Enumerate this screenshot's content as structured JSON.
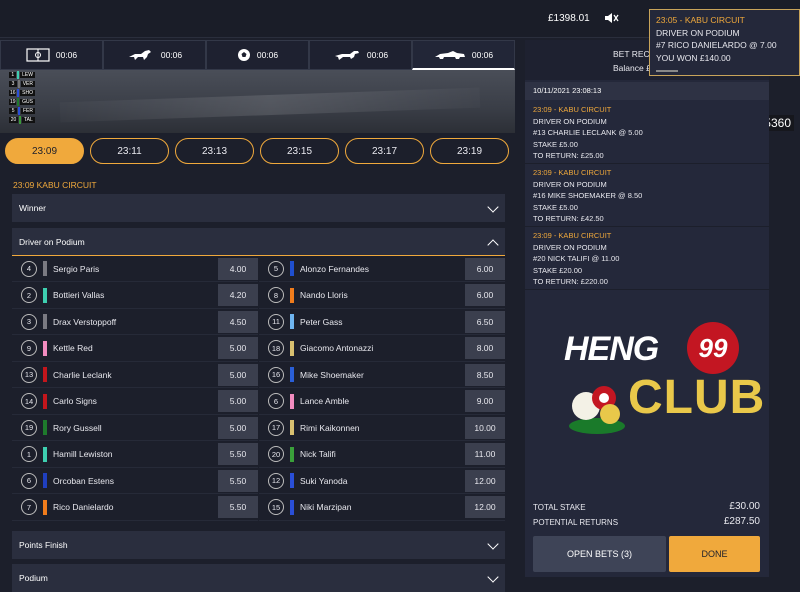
{
  "header": {
    "balance": "£1398.01"
  },
  "notification": {
    "title": "23:05 - KABU CIRCUIT",
    "line1": "DRIVER ON PODIUM",
    "line2": "#7 RICO DANIELARDO @ 7.00",
    "line3": "YOU WON £140.00"
  },
  "sport_tabs": [
    {
      "icon": "soccer-pitch-icon",
      "time": "00:06"
    },
    {
      "icon": "horse-racing-icon",
      "time": "00:06"
    },
    {
      "icon": "football-icon",
      "time": "00:06"
    },
    {
      "icon": "greyhound-icon",
      "time": "00:06"
    },
    {
      "icon": "motor-racing-icon",
      "time": "00:06"
    }
  ],
  "video": {
    "id_label": "ID:1065360",
    "standings": [
      {
        "pos": "1",
        "abbr": "LEW",
        "color": "#3ecfb0"
      },
      {
        "pos": "3",
        "abbr": "VER",
        "color": "#777777"
      },
      {
        "pos": "16",
        "abbr": "SHO",
        "color": "#2a4fd8"
      },
      {
        "pos": "19",
        "abbr": "GUS",
        "color": "#1e7a2c"
      },
      {
        "pos": "5",
        "abbr": "FER",
        "color": "#2a4fd8"
      },
      {
        "pos": "20",
        "abbr": "TAL",
        "color": "#3a9a3a"
      }
    ]
  },
  "race_times": [
    "23:09",
    "23:11",
    "23:13",
    "23:15",
    "23:17",
    "23:19"
  ],
  "event": {
    "title": "23:09 KABU CIRCUIT"
  },
  "markets": {
    "winner": "Winner",
    "driver_on_podium": "Driver on Podium",
    "points_finish": "Points Finish",
    "podium": "Podium"
  },
  "runners": [
    [
      {
        "num": "4",
        "name": "Sergio Paris",
        "color": "#7a7a82",
        "odds": "4.00"
      },
      {
        "num": "5",
        "name": "Alonzo Fernandes",
        "color": "#1f4fd0",
        "odds": "6.00"
      }
    ],
    [
      {
        "num": "2",
        "name": "Bottieri Vallas",
        "color": "#3ecfb0",
        "odds": "4.20"
      },
      {
        "num": "8",
        "name": "Nando Lloris",
        "color": "#f07c1c",
        "odds": "6.00"
      }
    ],
    [
      {
        "num": "3",
        "name": "Drax Verstoppoff",
        "color": "#7a7a82",
        "odds": "4.50"
      },
      {
        "num": "11",
        "name": "Peter Gass",
        "color": "#6fb5f0",
        "odds": "6.50"
      }
    ],
    [
      {
        "num": "9",
        "name": "Kettle Red",
        "color": "#f28cc0",
        "odds": "5.00"
      },
      {
        "num": "18",
        "name": "Giacomo Antonazzi",
        "color": "#d8c070",
        "odds": "8.00"
      }
    ],
    [
      {
        "num": "13",
        "name": "Charlie Leclank",
        "color": "#c3161c",
        "odds": "5.00"
      },
      {
        "num": "16",
        "name": "Mike Shoemaker",
        "color": "#2a5fd8",
        "odds": "8.50"
      }
    ],
    [
      {
        "num": "14",
        "name": "Carlo Signs",
        "color": "#c3161c",
        "odds": "5.00"
      },
      {
        "num": "6",
        "name": "Lance Amble",
        "color": "#f28cc0",
        "odds": "9.00"
      }
    ],
    [
      {
        "num": "19",
        "name": "Rory Gussell",
        "color": "#1e7a2c",
        "odds": "5.00"
      },
      {
        "num": "17",
        "name": "Rimi Kaikonnen",
        "color": "#d8c070",
        "odds": "10.00"
      }
    ],
    [
      {
        "num": "1",
        "name": "Hamill Lewiston",
        "color": "#3ecfb0",
        "odds": "5.50"
      },
      {
        "num": "20",
        "name": "Nick Talifi",
        "color": "#3aa03a",
        "odds": "11.00"
      }
    ],
    [
      {
        "num": "6",
        "name": "Orcoban Estens",
        "color": "#1f3fc0",
        "odds": "5.50"
      },
      {
        "num": "12",
        "name": "Suki Yanoda",
        "color": "#2a4fd8",
        "odds": "12.00"
      }
    ],
    [
      {
        "num": "7",
        "name": "Rico Danielardo",
        "color": "#f07c1c",
        "odds": "5.50"
      },
      {
        "num": "15",
        "name": "Niki Marzipan",
        "color": "#2a4fd8",
        "odds": "12.00"
      }
    ]
  ],
  "bet_receipt": {
    "title": "BET REC",
    "balance": "Balance £",
    "date": "10/11/2021 23:08:13",
    "slips": [
      {
        "title": "23:09 - KABU CIRCUIT",
        "market": "DRIVER ON PODIUM",
        "selection": "#13 CHARLIE LECLANK @ 5.00",
        "stake": "STAKE £5.00",
        "to_return": "TO RETURN: £25.00"
      },
      {
        "title": "23:09 - KABU CIRCUIT",
        "market": "DRIVER ON PODIUM",
        "selection": "#16 MIKE SHOEMAKER @ 8.50",
        "stake": "STAKE £5.00",
        "to_return": "TO RETURN: £42.50"
      },
      {
        "title": "23:09 - KABU CIRCUIT",
        "market": "DRIVER ON PODIUM",
        "selection": "#20 NICK TALIFI @ 11.00",
        "stake": "STAKE £20.00",
        "to_return": "TO RETURN: £220.00"
      }
    ],
    "total_stake_label": "TOTAL STAKE",
    "total_stake": "£30.00",
    "potential_returns_label": "POTENTIAL RETURNS",
    "potential_returns": "£287.50",
    "open_bets": "OPEN BETS (3)",
    "done": "DONE"
  },
  "logo": {
    "top": "HENG",
    "num": "99",
    "bottom": "CLUB",
    "accent": "#c31622",
    "gold": "#e9c84a"
  }
}
